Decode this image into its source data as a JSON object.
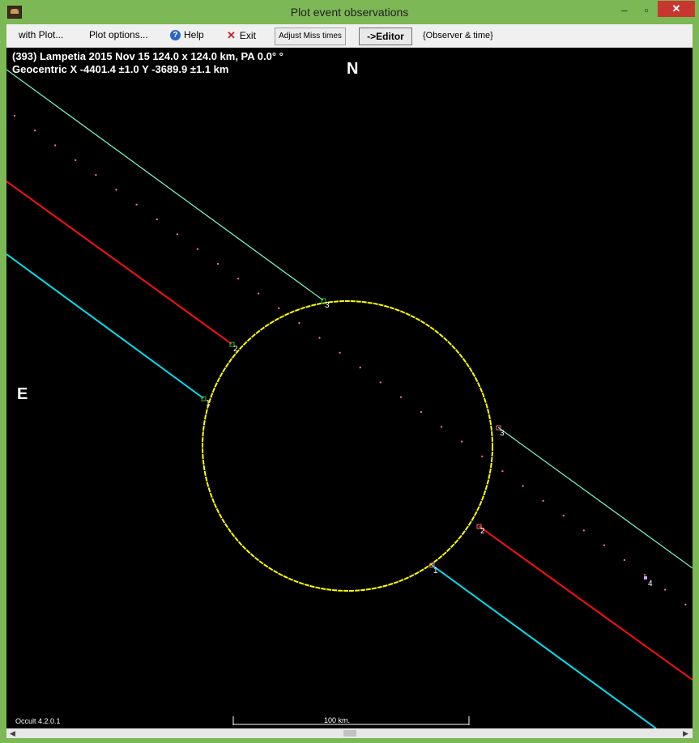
{
  "window": {
    "title": "Plot event observations",
    "minimize_glyph": "‒",
    "maximize_glyph": "▫",
    "close_glyph": "✕"
  },
  "menu": {
    "with_plot": "with Plot...",
    "plot_options": "Plot options...",
    "help": "Help",
    "exit": "Exit",
    "adjust_miss_times": "Adjust Miss times",
    "editor": "->Editor",
    "observer_time": "{Observer & time}"
  },
  "plot": {
    "header_line1": "(393) Lampetia  2015 Nov 15  124.0 x 124.0 km, PA 0.0° °",
    "header_line2": "Geocentric  X  -4401.4 ±1.0  Y  -3689.9 ±1.1 km",
    "north": "N",
    "east": "E",
    "scale_label": "100 km.",
    "version": "Occult 4.2.0.1",
    "chord_labels": {
      "c1_in": "1",
      "c2_in": "2",
      "c3_in": "3",
      "c1_out": "1",
      "c2_out": "2",
      "c3_out": "3",
      "c4": "4"
    }
  },
  "colors": {
    "window_frame": "#7cb855",
    "plot_bg": "#000000",
    "ellipse": "#ffff00",
    "chord1": "#00e0f0",
    "chord2": "#ff1010",
    "chord3": "#78f0b8",
    "chord4_dots": "#ff7070"
  },
  "icons": {
    "app": "app-icon",
    "help": "help-icon",
    "exit": "exit-icon"
  }
}
